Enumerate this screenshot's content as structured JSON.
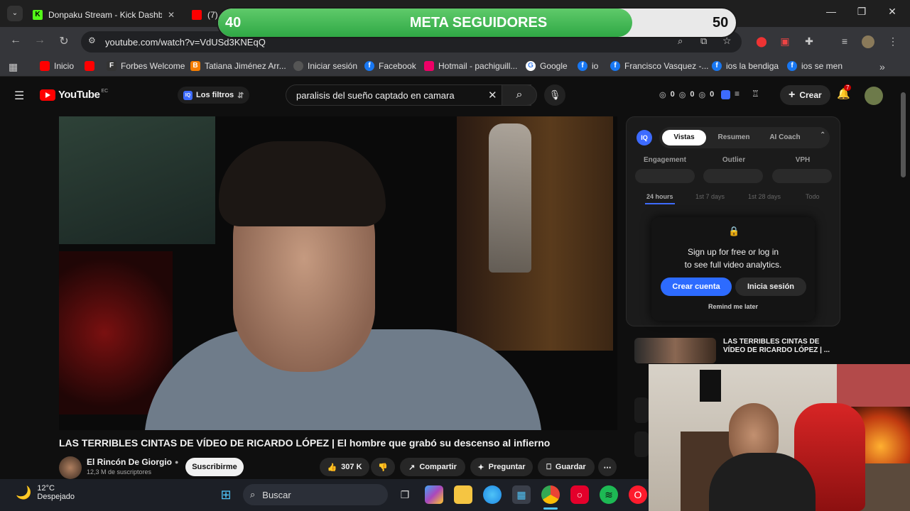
{
  "tabs": [
    {
      "title": "Donpaku Stream - Kick Dashbo",
      "close": "✕"
    },
    {
      "title": "(7)",
      "close": ""
    }
  ],
  "toolbar": {
    "url": "youtube.com/watch?v=VdUSd3KNEqQ"
  },
  "bookmarks": [
    {
      "label": "Inicio"
    },
    {
      "label": ""
    },
    {
      "label": "Forbes Welcome"
    },
    {
      "label": "Tatiana Jiménez Arr..."
    },
    {
      "label": "Iniciar sesión"
    },
    {
      "label": "Facebook"
    },
    {
      "label": "Hotmail - pachiguill..."
    },
    {
      "label": "Google"
    },
    {
      "label": "io"
    },
    {
      "label": "Francisco Vasquez -..."
    },
    {
      "label": "ios la bendiga"
    },
    {
      "label": "ios se men"
    }
  ],
  "youtube": {
    "logo_text": "YouTube",
    "logo_region": "EC",
    "filters_label": "Los filtros",
    "search_value": "paralisis del sueño captado en camara",
    "counters": [
      "0",
      "0",
      "0"
    ],
    "create_label": "Crear",
    "notif_count": "7"
  },
  "vidiq": {
    "badge": "IQ",
    "tabs": [
      "Vistas",
      "Resumen",
      "AI Coach"
    ],
    "stats": [
      "Engagement",
      "Outlier",
      "VPH"
    ],
    "ranges": [
      "24 hours",
      "1st 7 days",
      "1st 28 days",
      "Todo"
    ],
    "popup_line1": "Sign up for free or log in",
    "popup_line2": "to see full video analytics.",
    "create_account": "Crear cuenta",
    "login": "Inicia sesión",
    "remind": "Remind me later"
  },
  "sidebar_video": {
    "title": "LAS TERRIBLES CINTAS DE VÍDEO DE RICARDO LÓPEZ | ..."
  },
  "video": {
    "title": "LAS TERRIBLES CINTAS DE VÍDEO DE RICARDO LÓPEZ | El hombre que grabó su descenso al infierno",
    "channel": "El Rincón De Giorgio",
    "subscribers": "12,3 M de suscriptores",
    "subscribe_label": "Suscribirme",
    "likes": "307 K",
    "share_label": "Compartir",
    "ask_label": "Preguntar",
    "save_label": "Guardar"
  },
  "overlay": {
    "goal_label": "META SEGUIDORES",
    "current": "40",
    "target": "50",
    "progress": 0.8
  },
  "taskbar": {
    "temperature": "12°C",
    "weather": "Despejado",
    "search_placeholder": "Buscar"
  }
}
